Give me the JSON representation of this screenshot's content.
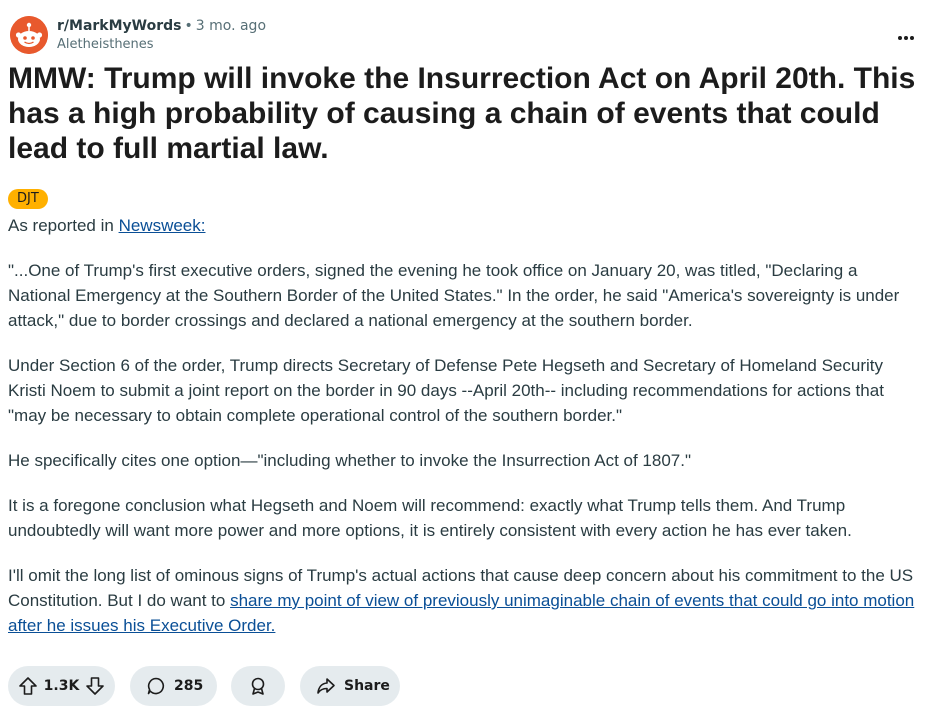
{
  "post": {
    "subreddit": "r/MarkMyWords",
    "separator": "•",
    "time": "3 mo. ago",
    "author": "Aletheisthenes",
    "title": "MMW: Trump will invoke the Insurrection Act on April 20th. This has a high probability of causing a chain of events that could lead to full martial law.",
    "flair": "DJT",
    "intro_text": "As reported in ",
    "intro_link": "Newsweek:",
    "paragraphs": [
      "\"...One of Trump's first executive orders, signed the evening he took office on January 20, was titled, \"Declaring a National Emergency at the Southern Border of the United States.\" In the order, he said \"America's sovereignty is under attack,\" due to border crossings and declared a national emergency at the southern border.",
      "Under Section 6 of the order, Trump directs Secretary of Defense Pete Hegseth and Secretary of Homeland Security Kristi Noem to submit a joint report on the border in 90 days --April 20th-- including recommendations for actions that \"may be necessary to obtain complete operational control of the southern border.\"",
      "He specifically cites one option—\"including whether to invoke the Insurrection Act of 1807.\"",
      "It is a foregone conclusion what Hegseth and Noem will recommend: exactly what Trump tells them. And Trump undoubtedly will want more power and more options, it is entirely consistent with every action he has ever taken."
    ],
    "last_text": "I'll omit the long list of ominous signs of Trump's actual actions that cause deep concern about his commitment to the US Constitution. But I do want to ",
    "last_link": "share my point of view of previously unimaginable chain of events that could go into motion after he issues his Executive Order."
  },
  "actions": {
    "vote_count": "1.3K",
    "comment_count": "285",
    "share_label": "Share",
    "icons": [
      "upvote-icon",
      "downvote-icon",
      "comment-icon",
      "award-icon",
      "share-icon",
      "more-options-icon"
    ]
  },
  "colors": {
    "avatar": "#e8592d",
    "flair": "#ffb000",
    "link": "#0a4f96",
    "pill": "#e5ebee"
  }
}
